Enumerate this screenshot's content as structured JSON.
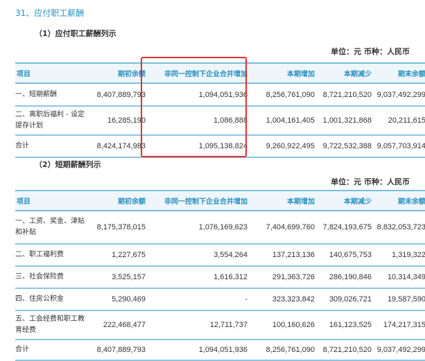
{
  "title": "31、应付职工薪酬",
  "section1": {
    "subtitle": "（1）应付职工薪酬列示",
    "unit": "单位：元  币种：人民币",
    "headers": [
      "项目",
      "期初余额",
      "非同一控制下企业合并增加",
      "本期增加",
      "本期减少",
      "期末余额"
    ],
    "rows": [
      [
        "一、短期薪酬",
        "8,407,889,793",
        "1,094,051,936",
        "8,256,761,090",
        "8,721,210,520",
        "9,037,492,299"
      ],
      [
        "二、离职后福利 - 设定提存计划",
        "16,285,190",
        "1,086,888",
        "1,004,161,405",
        "1,001,321,868",
        "20,211,615"
      ],
      [
        "合计",
        "8,424,174,983",
        "1,095,138,824",
        "9,260,922,495",
        "9,722,532,388",
        "9,057,703,914"
      ]
    ]
  },
  "section2": {
    "subtitle": "（2）短期薪酬列示",
    "unit": "单位：元  币种：人民币",
    "headers": [
      "项目",
      "期初余额",
      "非同一控制下企业合并增加",
      "本期增加",
      "本期减少",
      "期末余额"
    ],
    "rows": [
      [
        "一、工资、奖金、津贴和补贴",
        "8,175,378,015",
        "1,076,169,623",
        "7,404,699,760",
        "7,824,193,675",
        "8,832,053,723"
      ],
      [
        "二、职工福利费",
        "1,227,675",
        "3,554,264",
        "137,213,136",
        "140,675,753",
        "1,319,322"
      ],
      [
        "三、社会保险费",
        "3,525,157",
        "1,616,312",
        "291,363,726",
        "286,190,846",
        "10,314,349"
      ],
      [
        "四、住房公积金",
        "5,290,469",
        "-",
        "323,323,842",
        "309,026,721",
        "19,587,590"
      ],
      [
        "五、工会经费和职工教育经费",
        "222,468,477",
        "12,711,737",
        "100,160,626",
        "161,123,525",
        "174,217,315"
      ],
      [
        "合计",
        "8,407,889,793",
        "1,094,051,936",
        "8,256,761,090",
        "8,721,210,520",
        "9,037,492,299"
      ]
    ]
  },
  "highlight_color": "#e0302a"
}
